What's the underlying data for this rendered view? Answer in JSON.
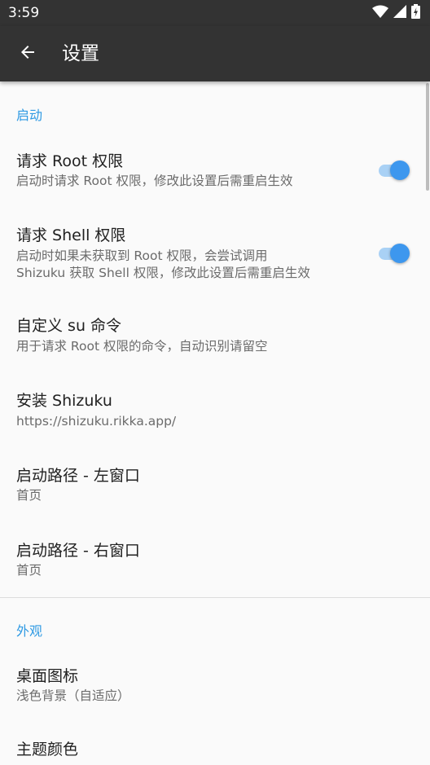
{
  "status_bar": {
    "time": "3:59"
  },
  "toolbar": {
    "title": "设置"
  },
  "sections": {
    "startup": {
      "header": "启动",
      "items": [
        {
          "title": "请求 Root 权限",
          "summary": "启动时请求 Root 权限，修改此设置后需重启生效"
        },
        {
          "title": "请求 Shell 权限",
          "summary_line1": "启动时如果未获取到 Root 权限，会尝试调用",
          "summary_line2": "Shizuku 获取 Shell 权限，修改此设置后需重启生效"
        },
        {
          "title": "自定义 su 命令",
          "summary": "用于请求 Root 权限的命令，自动识别请留空"
        },
        {
          "title": "安装 Shizuku",
          "summary": "https://shizuku.rikka.app/"
        },
        {
          "title": "启动路径 - 左窗口",
          "summary": "首页"
        },
        {
          "title": "启动路径 - 右窗口",
          "summary": "首页"
        }
      ]
    },
    "appearance": {
      "header": "外观",
      "items": [
        {
          "title": "桌面图标",
          "summary": "浅色背景（自适应）"
        },
        {
          "title": "主题颜色"
        }
      ]
    }
  },
  "colors": {
    "bar": "#333333",
    "accent": "#2f9ae3",
    "switch_thumb": "#3d97ee",
    "switch_track": "#a9d1f5"
  },
  "icons": {
    "back": "arrow-left-icon",
    "wifi": "wifi-icon",
    "signal": "cell-signal-icon",
    "battery": "battery-charging-icon"
  }
}
